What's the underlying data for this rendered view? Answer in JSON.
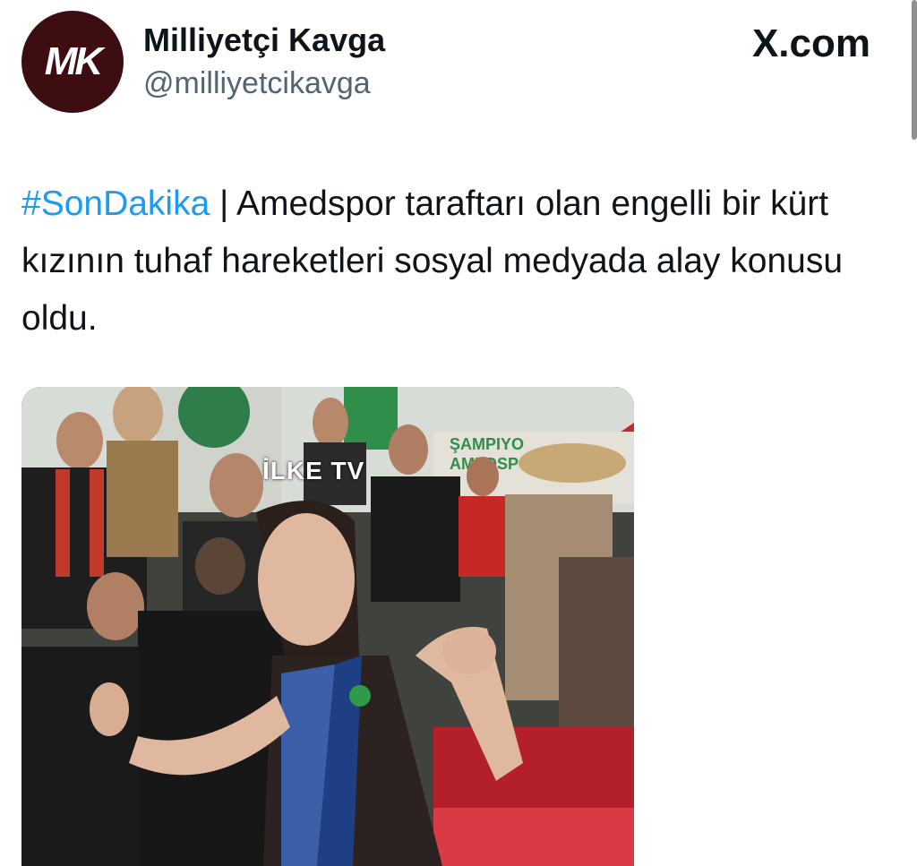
{
  "author": {
    "display_name": "Milliyetçi Kavga",
    "handle": "@milliyetcikavga",
    "avatar_initials": "MK"
  },
  "source": {
    "label": "X.com"
  },
  "tweet": {
    "hashtag": "#SonDakika",
    "separator": " | ",
    "body": "Amedspor taraftarı olan engelli bir kürt kızının tuhaf hareketleri sosyal medyada alay konusu oldu."
  },
  "media": {
    "watermark": "İLKE TV",
    "banner_text": "ŞAMPIYO",
    "banner_text_2": "AMEDSP"
  },
  "colors": {
    "link": "#1d9bf0",
    "avatar_bg": "#3e0d12"
  }
}
